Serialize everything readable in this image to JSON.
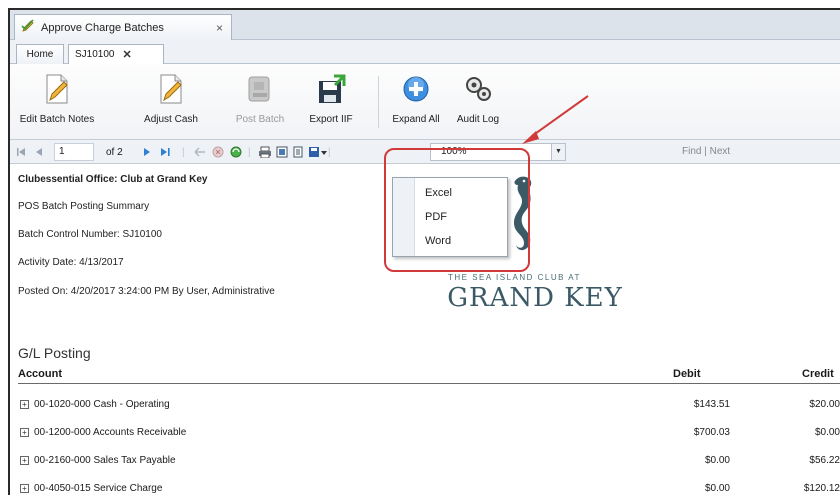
{
  "window": {
    "tab_title": "Approve Charge Batches",
    "close_glyph": "×"
  },
  "page_tabs": {
    "home": "Home",
    "current": "SJ10100",
    "close_glyph": "✕"
  },
  "ribbon": {
    "edit_batch_notes": "Edit Batch Notes",
    "adjust_cash": "Adjust Cash",
    "post_batch": "Post Batch",
    "export_iif": "Export IIF",
    "expand_all": "Expand All",
    "audit_log": "Audit Log"
  },
  "report_toolbar": {
    "page_value": "1",
    "page_of": "of 2",
    "zoom": "100%",
    "find_label": "Find",
    "separator": "|",
    "next_label": "Next"
  },
  "export_menu": {
    "items": [
      "Excel",
      "PDF",
      "Word"
    ]
  },
  "report": {
    "header_lines": [
      "Clubessential Office: Club at Grand Key",
      "POS Batch Posting Summary",
      "Batch Control Number: SJ10100",
      "Activity Date: 4/13/2017",
      "Posted On: 4/20/2017 3:24:00 PM By User, Administrative"
    ],
    "logo_tagline": "THE SEA ISLAND CLUB AT",
    "logo_name": "GRAND KEY",
    "section_title": "G/L Posting",
    "columns": {
      "account": "Account",
      "debit": "Debit",
      "credit": "Credit"
    },
    "rows": [
      {
        "account": "00-1020-000 Cash - Operating",
        "debit": "$143.51",
        "credit": "$20.00"
      },
      {
        "account": "00-1200-000 Accounts Receivable",
        "debit": "$700.03",
        "credit": "$0.00"
      },
      {
        "account": "00-2160-000 Sales Tax Payable",
        "debit": "$0.00",
        "credit": "$56.22"
      },
      {
        "account": "00-4050-015 Service Charge",
        "debit": "$0.00",
        "credit": "$120.12"
      }
    ]
  },
  "colors": {
    "annotation": "#d23a3a",
    "accent": "#2f7fd6",
    "logo": "#3b5a66"
  }
}
